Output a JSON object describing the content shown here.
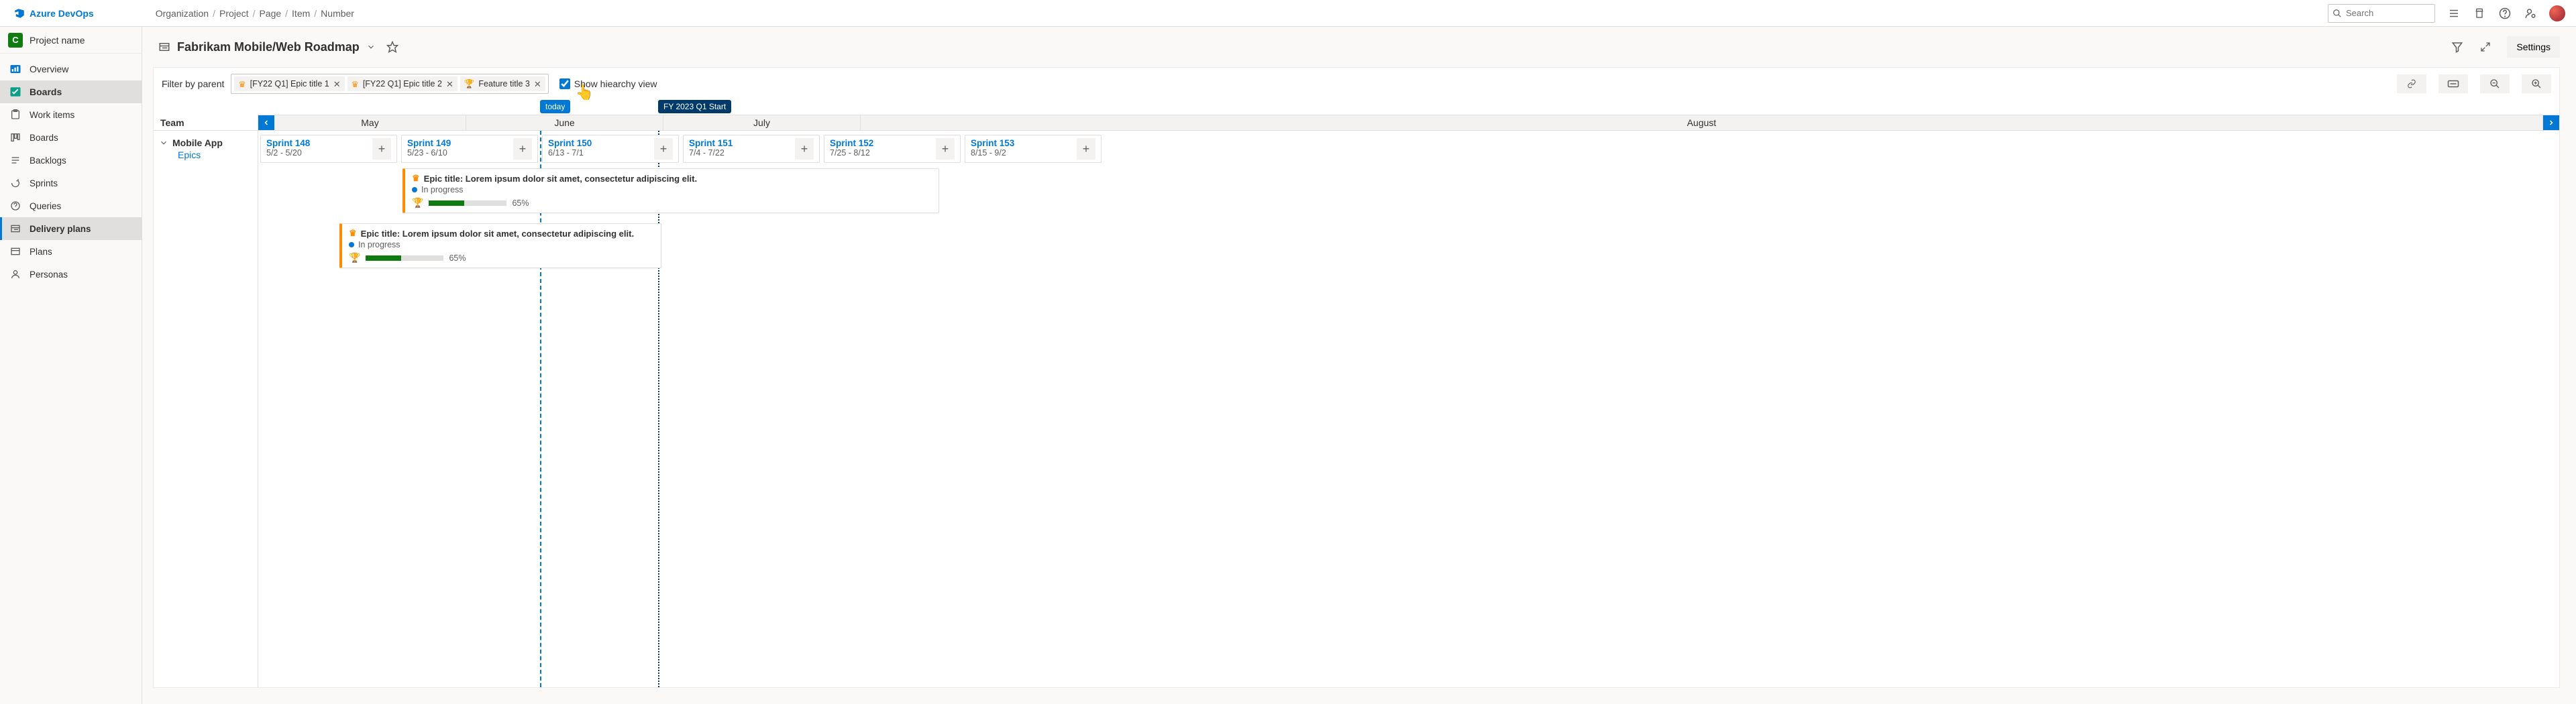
{
  "brand": "Azure DevOps",
  "breadcrumbs": [
    "Organization",
    "Project",
    "Page",
    "Item",
    "Number"
  ],
  "search_placeholder": "Search",
  "project": {
    "badge": "C",
    "name": "Project name"
  },
  "nav": {
    "overview": "Overview",
    "boards": "Boards",
    "work_items": "Work items",
    "boards_sub": "Boards",
    "backlogs": "Backlogs",
    "sprints": "Sprints",
    "queries": "Queries",
    "delivery_plans": "Delivery plans",
    "plans": "Plans",
    "personas": "Personas"
  },
  "page_title": "Fabrikam Mobile/Web Roadmap",
  "settings_label": "Settings",
  "filter": {
    "label": "Filter by parent",
    "chips": [
      {
        "kind": "epic",
        "text": "[FY22 Q1] Epic title 1"
      },
      {
        "kind": "epic",
        "text": "[FY22 Q1] Epic title 2"
      },
      {
        "kind": "feature",
        "text": "Feature title 3"
      }
    ],
    "hierarchy_label": "Show hiearchy view",
    "hierarchy_checked": true
  },
  "markers": {
    "today": "today",
    "milestone": "FY 2023 Q1 Start"
  },
  "team_header": "Team",
  "months": [
    "May",
    "June",
    "July",
    "August"
  ],
  "team": {
    "name": "Mobile App",
    "subline": "Epics"
  },
  "sprints": [
    {
      "title": "Sprint 148",
      "dates": "5/2 - 5/20"
    },
    {
      "title": "Sprint 149",
      "dates": "5/23 - 6/10"
    },
    {
      "title": "Sprint 150",
      "dates": "6/13 - 7/1"
    },
    {
      "title": "Sprint 151",
      "dates": "7/4 - 7/22"
    },
    {
      "title": "Sprint 152",
      "dates": "7/25 - 8/12"
    },
    {
      "title": "Sprint 153",
      "dates": "8/15 - 9/2"
    }
  ],
  "cards": [
    {
      "title": "Epic title: Lorem ipsum dolor sit amet, consectetur adipiscing elit.",
      "status": "In progress",
      "percent": "65%",
      "fill": 45
    },
    {
      "title": "Epic title: Lorem ipsum dolor sit amet, consectetur adipiscing elit.",
      "status": "In progress",
      "percent": "65%",
      "fill": 45
    }
  ]
}
